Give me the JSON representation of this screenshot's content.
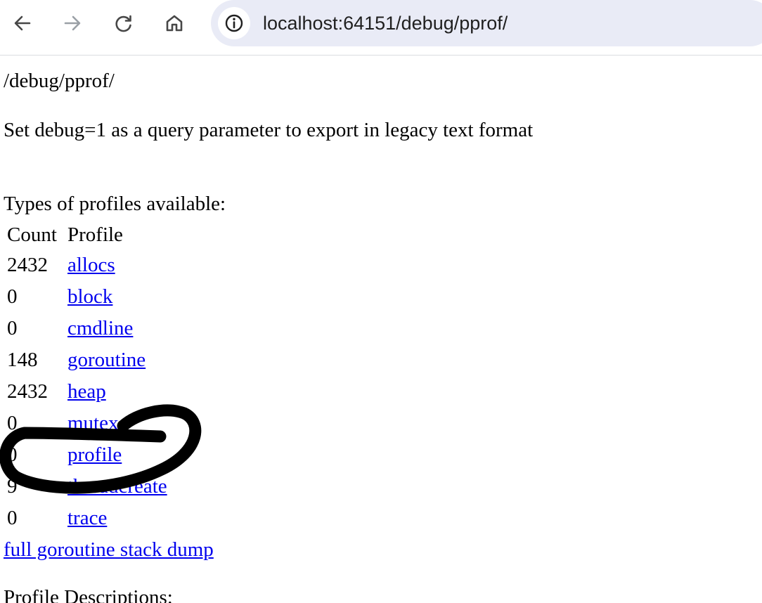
{
  "browser": {
    "url": "localhost:64151/debug/pprof/",
    "icons": {
      "back": "arrow-left-icon",
      "forward": "arrow-right-icon",
      "reload": "reload-icon",
      "home": "home-icon",
      "site_info": "info-icon"
    }
  },
  "page": {
    "path": "/debug/pprof/",
    "hint": "Set debug=1 as a query parameter to export in legacy text format",
    "types_heading": "Types of profiles available:",
    "table": {
      "headers": [
        "Count",
        "Profile"
      ],
      "rows": [
        {
          "count": "2432",
          "profile": "allocs"
        },
        {
          "count": "0",
          "profile": "block"
        },
        {
          "count": "0",
          "profile": "cmdline"
        },
        {
          "count": "148",
          "profile": "goroutine"
        },
        {
          "count": "2432",
          "profile": "heap"
        },
        {
          "count": "0",
          "profile": "mutex"
        },
        {
          "count": "0",
          "profile": "profile"
        },
        {
          "count": "9",
          "profile": "threadcreate"
        },
        {
          "count": "0",
          "profile": "trace"
        }
      ]
    },
    "full_dump_link": "full goroutine stack dump",
    "descriptions_heading": "Profile Descriptions:"
  },
  "colors": {
    "link": "#0000ee",
    "omnibox_bg": "#e9ebf6",
    "annotation": "#000000"
  }
}
